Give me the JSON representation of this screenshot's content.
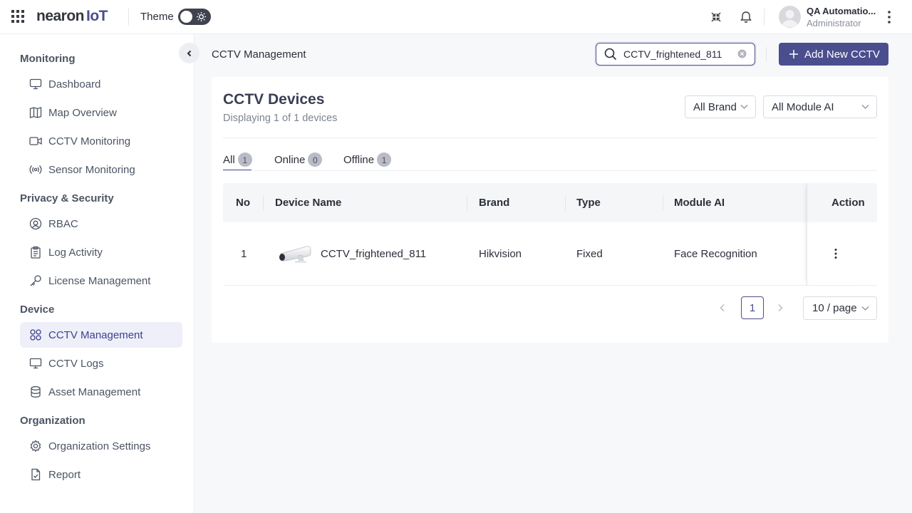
{
  "header": {
    "logo_main": "nearon",
    "logo_accent": "IoT",
    "theme_label": "Theme",
    "user_name": "QA Automatio...",
    "user_role": "Administrator"
  },
  "sidebar": {
    "sections": [
      {
        "title": "Monitoring"
      },
      {
        "title": "Privacy & Security"
      },
      {
        "title": "Device"
      },
      {
        "title": "Organization"
      }
    ],
    "items": [
      {
        "label": "Dashboard",
        "icon": "monitor-icon"
      },
      {
        "label": "Map Overview",
        "icon": "map-icon"
      },
      {
        "label": "CCTV Monitoring",
        "icon": "video-icon"
      },
      {
        "label": "Sensor Monitoring",
        "icon": "broadcast-icon"
      },
      {
        "label": "RBAC",
        "icon": "user-circle-icon"
      },
      {
        "label": "Log Activity",
        "icon": "clipboard-icon"
      },
      {
        "label": "License Management",
        "icon": "key-icon"
      },
      {
        "label": "CCTV Management",
        "icon": "grid-icon",
        "active": true
      },
      {
        "label": "CCTV Logs",
        "icon": "desktop-icon"
      },
      {
        "label": "Asset Management",
        "icon": "database-icon"
      },
      {
        "label": "Organization Settings",
        "icon": "gear-icon"
      },
      {
        "label": "Report",
        "icon": "report-icon"
      }
    ]
  },
  "main": {
    "breadcrumb": "CCTV Management",
    "search_value": "CCTV_frightened_811",
    "add_button": "Add New CCTV",
    "card_title": "CCTV Devices",
    "card_subtitle": "Displaying 1 of 1 devices",
    "filters": {
      "brand": "All Brand",
      "module": "All Module AI"
    },
    "tabs": [
      {
        "label": "All",
        "count": "1",
        "active": true
      },
      {
        "label": "Online",
        "count": "0"
      },
      {
        "label": "Offline",
        "count": "1"
      }
    ],
    "table": {
      "columns": [
        "No",
        "Device Name",
        "Brand",
        "Type",
        "Module AI",
        "Action"
      ],
      "rows": [
        {
          "no": "1",
          "device_name": "CCTV_frightened_811",
          "brand": "Hikvision",
          "type": "Fixed",
          "module_ai": "Face Recognition"
        }
      ]
    },
    "pagination": {
      "current_page": "1",
      "page_size": "10 / page"
    }
  },
  "colors": {
    "accent": "#4a4e8f",
    "active_bg": "#eeeff8",
    "badge": "#b9bcc6"
  }
}
